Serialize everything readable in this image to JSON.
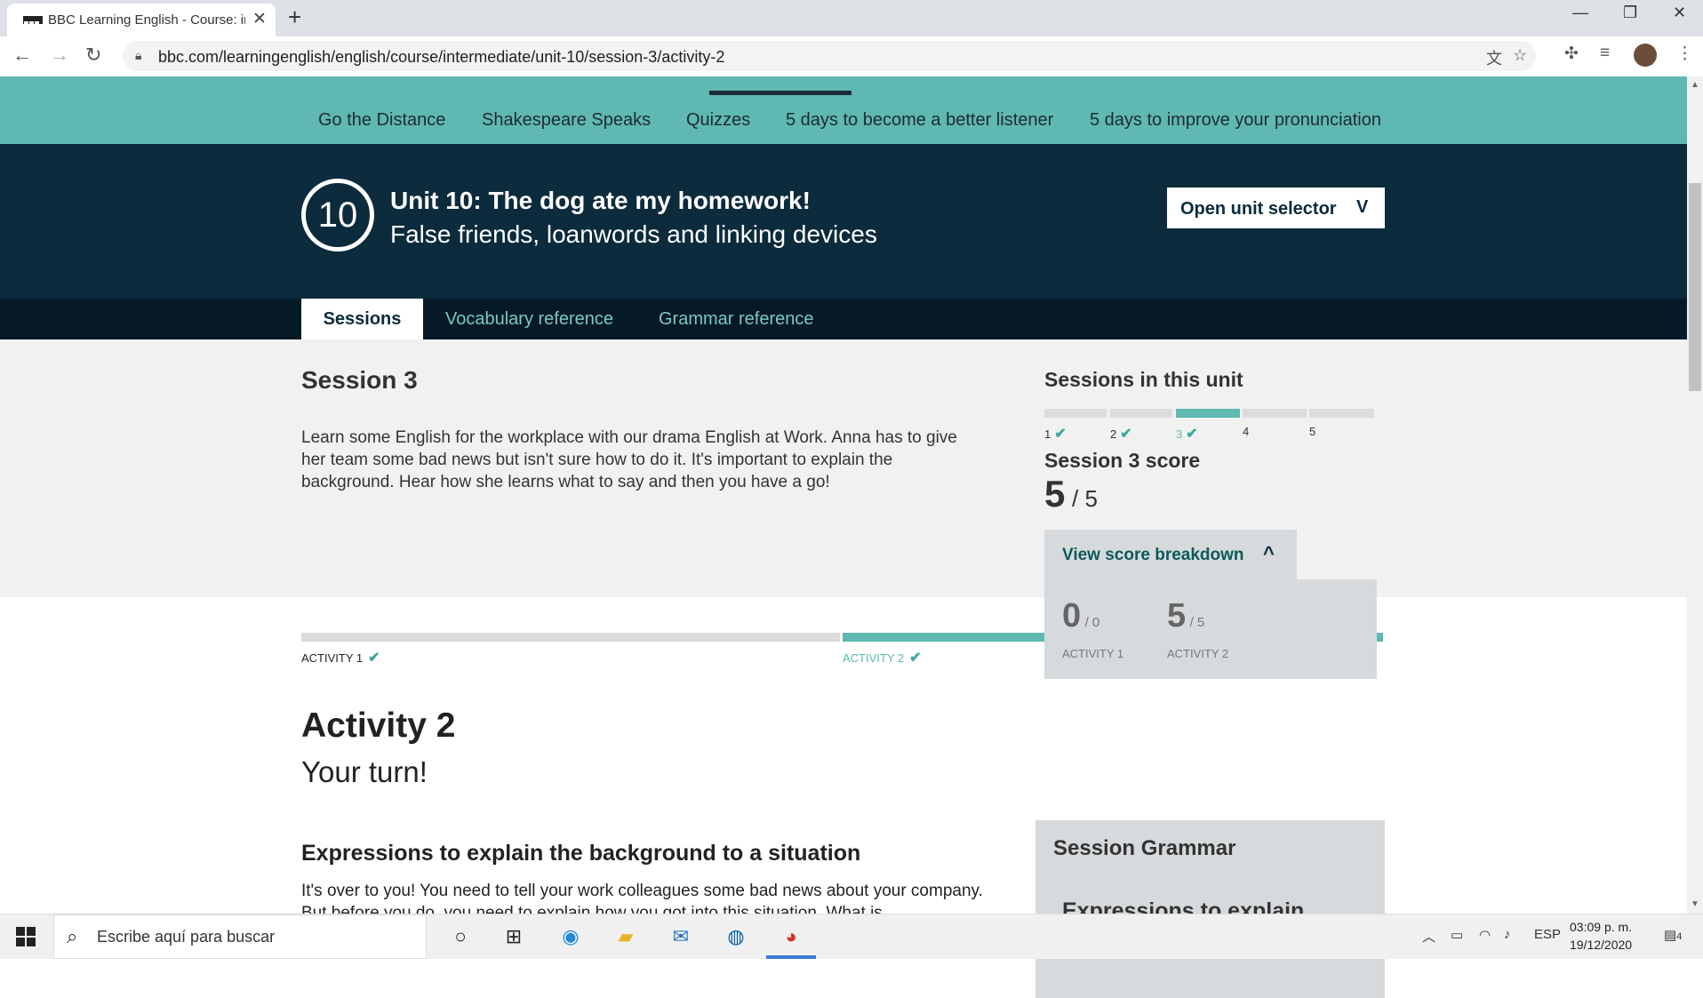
{
  "browser": {
    "tab_title": "BBC Learning English - Course: intermediate",
    "tab_close": "✕",
    "new_tab": "+",
    "url": "bbc.com/learningenglish/english/course/intermediate/unit-10/session-3/activity-2",
    "window_controls": {
      "minimize": "—",
      "restore": "❐",
      "close": "✕"
    }
  },
  "site_nav": {
    "links": [
      "Go the Distance",
      "Shakespeare Speaks",
      "Quizzes",
      "5 days to become a better listener",
      "5 days to improve your pronunciation"
    ]
  },
  "unit": {
    "number": "10",
    "title": "Unit 10: The dog ate my homework!",
    "subtitle": "False friends, loanwords and linking devices",
    "selector_label": "Open unit selector",
    "selector_chevron": "V"
  },
  "section_tabs": {
    "sessions": "Sessions",
    "vocabulary": "Vocabulary reference",
    "grammar": "Grammar reference"
  },
  "session": {
    "title": "Session 3",
    "description": "Learn some English for the workplace with our drama English at Work. Anna has to give her team some bad news but isn't sure how to do it. It's important to explain the background. Hear how she learns what to say and then you have a go!"
  },
  "sessions_in_unit": {
    "title": "Sessions in this unit",
    "items": [
      {
        "label": "1",
        "done": "✔"
      },
      {
        "label": "2",
        "done": "✔"
      },
      {
        "label": "3",
        "done": "✔"
      },
      {
        "label": "4",
        "done": ""
      },
      {
        "label": "5",
        "done": ""
      }
    ],
    "current_index": 2
  },
  "score": {
    "title": "Session 3 score",
    "value": "5",
    "total": "/ 5",
    "breakdown_label": "View score breakdown",
    "breakdown_chevron": "^",
    "breakdown": [
      {
        "score": "0",
        "of": "/ 0",
        "label": "ACTIVITY 1"
      },
      {
        "score": "5",
        "of": "/ 5",
        "label": "ACTIVITY 2"
      }
    ]
  },
  "activities_progress": [
    {
      "label": "ACTIVITY 1",
      "done": "✔"
    },
    {
      "label": "ACTIVITY 2",
      "done": "✔"
    }
  ],
  "activity": {
    "title": "Activity 2",
    "subtitle": "Your turn!",
    "section_title": "Expressions to explain the background to a situation",
    "body": "It's over to you! You need to tell your work colleagues some bad news about your company. But before you do, you need to explain how you got into this situation. What is"
  },
  "grammar_box": {
    "title": "Session Grammar",
    "subtitle": "Expressions to explain"
  },
  "taskbar": {
    "search_placeholder": "Escribe aquí para buscar",
    "language": "ESP",
    "time": "03:09 p. m.",
    "date": "19/12/2020",
    "notifications": "4"
  },
  "colors": {
    "teal": "#5fb8b1",
    "navy": "#0c2b3c",
    "dark": "#051a26"
  }
}
